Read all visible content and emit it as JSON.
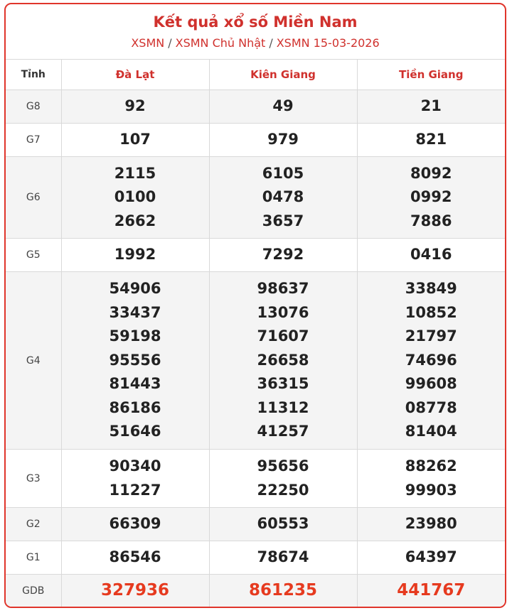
{
  "header": {
    "title": "Kết quả xổ số Miền Nam",
    "crumb_1": "XSMN",
    "crumb_2": "XSMN Chủ Nhật",
    "crumb_3": "XSMN 15-03-2026",
    "separator": "/"
  },
  "table": {
    "first_col_header": "Tỉnh",
    "provinces": [
      "Đà Lạt",
      "Kiên Giang",
      "Tiền Giang"
    ],
    "rows": [
      {
        "prize": "G8",
        "values": [
          [
            "92"
          ],
          [
            "49"
          ],
          [
            "21"
          ]
        ]
      },
      {
        "prize": "G7",
        "values": [
          [
            "107"
          ],
          [
            "979"
          ],
          [
            "821"
          ]
        ]
      },
      {
        "prize": "G6",
        "values": [
          [
            "2115",
            "0100",
            "2662"
          ],
          [
            "6105",
            "0478",
            "3657"
          ],
          [
            "8092",
            "0992",
            "7886"
          ]
        ]
      },
      {
        "prize": "G5",
        "values": [
          [
            "1992"
          ],
          [
            "7292"
          ],
          [
            "0416"
          ]
        ]
      },
      {
        "prize": "G4",
        "values": [
          [
            "54906",
            "33437",
            "59198",
            "95556",
            "81443",
            "86186",
            "51646"
          ],
          [
            "98637",
            "13076",
            "71607",
            "26658",
            "36315",
            "11312",
            "41257"
          ],
          [
            "33849",
            "10852",
            "21797",
            "74696",
            "99608",
            "08778",
            "81404"
          ]
        ]
      },
      {
        "prize": "G3",
        "values": [
          [
            "90340",
            "11227"
          ],
          [
            "95656",
            "22250"
          ],
          [
            "88262",
            "99903"
          ]
        ]
      },
      {
        "prize": "G2",
        "values": [
          [
            "66309"
          ],
          [
            "60553"
          ],
          [
            "23980"
          ]
        ]
      },
      {
        "prize": "G1",
        "values": [
          [
            "86546"
          ],
          [
            "78674"
          ],
          [
            "64397"
          ]
        ]
      },
      {
        "prize": "GDB",
        "values": [
          [
            "327936"
          ],
          [
            "861235"
          ],
          [
            "441767"
          ]
        ]
      }
    ]
  },
  "colors": {
    "accent": "#d0312d",
    "special": "#e63a1f",
    "shade": "#f4f4f4"
  }
}
